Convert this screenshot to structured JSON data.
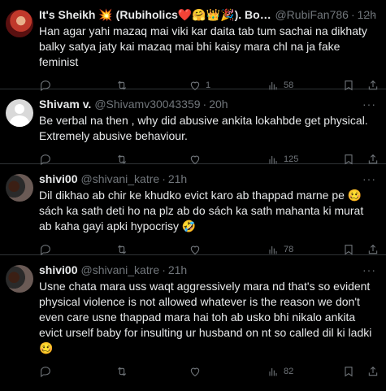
{
  "tweets": [
    {
      "name": "It's Sheikh 💥 (Rubiholics❤️🤗👑🎉). Boy.🔥",
      "handle": "@RubiFan786",
      "time": "12h",
      "text": "Han agar yahi mazaq mai viki kar daita tab tum sachai na dikhaty balky satya jaty kai mazaq mai bhi kaisy mara chl na ja fake feminist",
      "replies": "",
      "retweets": "",
      "likes": "1",
      "views": "58"
    },
    {
      "name": "Shivam v.",
      "handle": "@Shivamv30043359",
      "time": "20h",
      "text": "Be verbal na then , why did abusive ankita lokahbde get physical. Extremely abusive behaviour.",
      "replies": "",
      "retweets": "",
      "likes": "",
      "views": "125"
    },
    {
      "name": "shivi00",
      "handle": "@shivani_katre",
      "time": "21h",
      "text": "Dil dikhao ab chir ke khudko evict karo ab thappad marne pe 🥴 sách ka sath deti ho na plz ab do sách ka sath mahanta ki murat ab kaha gayi apki hypocrisy 🤣",
      "replies": "",
      "retweets": "",
      "likes": "",
      "views": "78"
    },
    {
      "name": "shivi00",
      "handle": "@shivani_katre",
      "time": "21h",
      "text": "Usne chata mara uss waqt aggressively mara nd that's so evident physical violence is not allowed whatever is the reason we don't even care usne thappad mara hai toh ab usko bhi nikalo ankita evict urself baby for insulting ur husband on nt so called dil ki ladki 🥴",
      "replies": "",
      "retweets": "",
      "likes": "",
      "views": "82"
    }
  ],
  "separator": "·",
  "more_glyph": "···"
}
